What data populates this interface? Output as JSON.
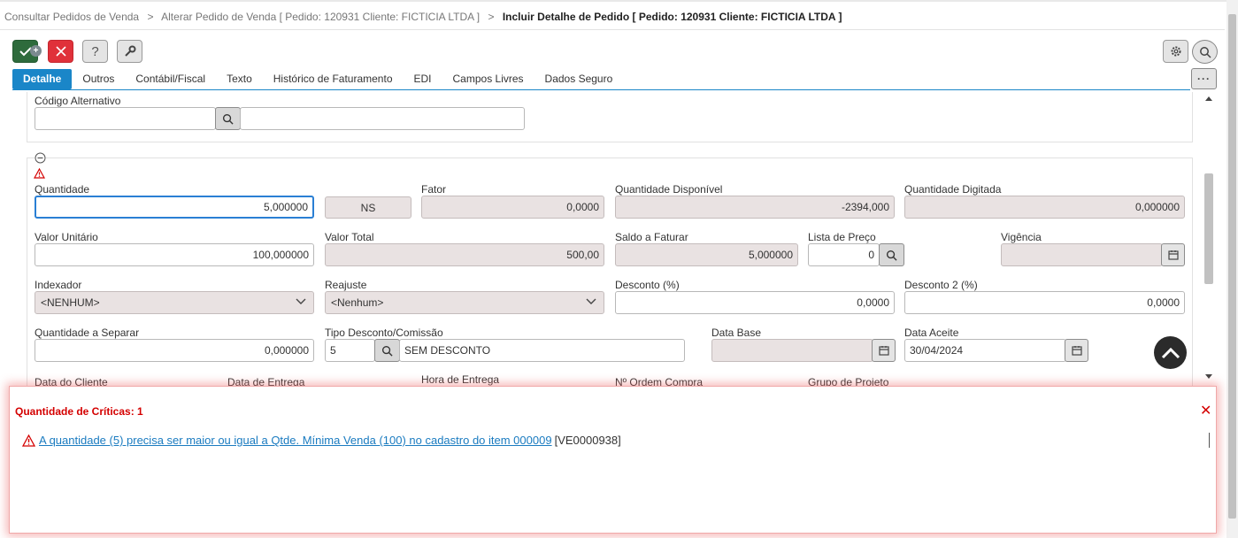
{
  "breadcrumb": {
    "items": [
      "Consultar Pedidos de Venda",
      "Alterar Pedido de Venda [ Pedido: 120931 Cliente: FICTICIA LTDA ]"
    ],
    "separator": ">",
    "current": "Incluir Detalhe de Pedido [ Pedido: 120931 Cliente: FICTICIA LTDA ]"
  },
  "toolbar": {
    "ok_badge": "+",
    "help_label": "?",
    "more_label": "···",
    "icons": [
      "check-icon",
      "close-icon",
      "help-icon",
      "wrench-icon",
      "gear-icon",
      "search-icon",
      "more-icon"
    ]
  },
  "tabs": [
    {
      "label": "Detalhe",
      "active": true
    },
    {
      "label": "Outros"
    },
    {
      "label": "Contábil/Fiscal"
    },
    {
      "label": "Texto"
    },
    {
      "label": "Histórico de Faturamento"
    },
    {
      "label": "EDI"
    },
    {
      "label": "Campos Livres"
    },
    {
      "label": "Dados Seguro"
    }
  ],
  "form": {
    "codigo_alternativo": {
      "label": "Código Alternativo",
      "value": "",
      "desc": ""
    },
    "quantidade": {
      "label": "Quantidade",
      "value": "5,000000"
    },
    "unidade": {
      "value": "NS"
    },
    "fator": {
      "label": "Fator",
      "value": "0,0000"
    },
    "quantidade_disponivel": {
      "label": "Quantidade Disponível",
      "value": "-2394,000"
    },
    "quantidade_digitada": {
      "label": "Quantidade Digitada",
      "value": "0,000000"
    },
    "valor_unitario": {
      "label": "Valor Unitário",
      "value": "100,000000"
    },
    "valor_total": {
      "label": "Valor Total",
      "value": "500,00"
    },
    "saldo_a_faturar": {
      "label": "Saldo a Faturar",
      "value": "5,000000"
    },
    "lista_de_preco": {
      "label": "Lista de Preço",
      "value": "0"
    },
    "vigencia": {
      "label": "Vigência",
      "value": ""
    },
    "indexador": {
      "label": "Indexador",
      "value": "<NENHUM>"
    },
    "reajuste": {
      "label": "Reajuste",
      "value": "<Nenhum>"
    },
    "desconto": {
      "label": "Desconto (%)",
      "value": "0,0000"
    },
    "desconto2": {
      "label": "Desconto 2 (%)",
      "value": "0,0000"
    },
    "quantidade_a_separar": {
      "label": "Quantidade a Separar",
      "value": "0,000000"
    },
    "tipo_desconto": {
      "label": "Tipo Desconto/Comissão",
      "code": "5",
      "desc": "SEM DESCONTO"
    },
    "data_base": {
      "label": "Data Base",
      "value": ""
    },
    "data_aceite": {
      "label": "Data Aceite",
      "value": "30/04/2024"
    },
    "data_do_cliente": {
      "label": "Data do Cliente"
    },
    "data_de_entrega": {
      "label": "Data de Entrega"
    },
    "hora_de_entrega": {
      "label": "Hora de Entrega"
    },
    "ordem_compra": {
      "label": "Nº Ordem Compra"
    },
    "grupo_de_projeto": {
      "label": "Grupo de Projeto"
    }
  },
  "criticas": {
    "title": "Quantidade de Críticas: 1",
    "close": "✕",
    "items": [
      {
        "message": "A quantidade (5) precisa ser maior ou igual a Qtde. Mínima Venda (100) no cadastro do item 000009",
        "code": "[VE0000938]"
      }
    ]
  },
  "colors": {
    "accent": "#1a86c8",
    "ok": "#2e6b3c",
    "cancel": "#e0313a",
    "critical": "#d40000",
    "link": "#1a7bc0",
    "readonly_bg": "#e9e2e2"
  }
}
